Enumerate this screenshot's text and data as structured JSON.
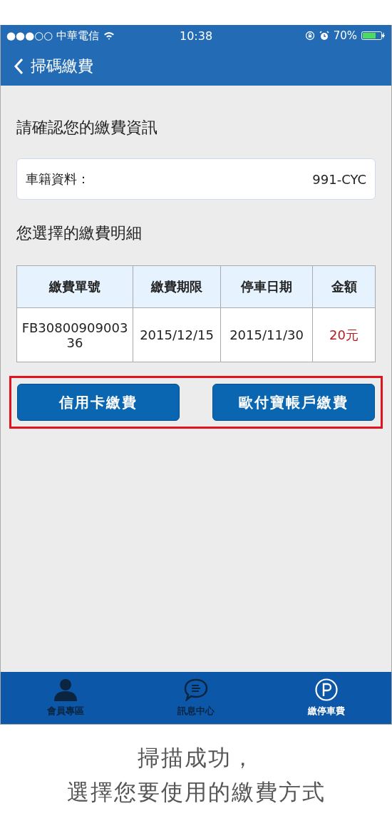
{
  "status_bar": {
    "carrier": "●●●○○ 中華電信",
    "time": "10:38",
    "battery": "70%"
  },
  "nav": {
    "title": "掃碼繳費"
  },
  "confirm_heading": "請確認您的繳費資訊",
  "vehicle": {
    "label": "車籍資料：",
    "value": "991-CYC"
  },
  "detail_heading": "您選擇的繳費明細",
  "table": {
    "columns": [
      "繳費單號",
      "繳費期限",
      "停車日期",
      "金額"
    ],
    "rows": [
      [
        "FB30800909003 36",
        "2015/12/15",
        "2015/11/30",
        "20元"
      ]
    ]
  },
  "highlight": true,
  "buttons": [
    "信用卡繳費",
    "歐付寶帳戶繳費"
  ],
  "tab_bar": [
    {
      "kind": "person",
      "label": "會員專區",
      "selected": false
    },
    {
      "kind": "chat",
      "label": "訊息中心",
      "selected": false
    },
    {
      "kind": "parking",
      "label": "繳停車費",
      "selected": true
    }
  ],
  "caption": [
    "掃描成功，",
    "選擇您要使用的繳費方式"
  ]
}
